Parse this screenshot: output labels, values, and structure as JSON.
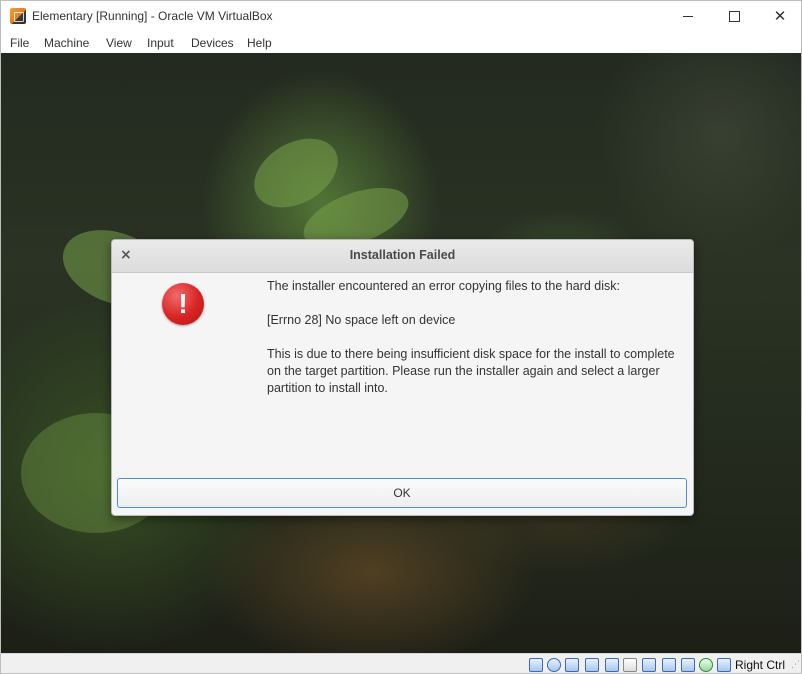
{
  "window": {
    "title": "Elementary [Running] - Oracle VM VirtualBox",
    "controls": {
      "minimize": "",
      "maximize": "",
      "close": "✕"
    }
  },
  "menu": [
    {
      "label": "File"
    },
    {
      "label": "Machine"
    },
    {
      "label": "View"
    },
    {
      "label": "Input"
    },
    {
      "label": "Devices"
    },
    {
      "label": "Help"
    }
  ],
  "dialog": {
    "close_glyph": "×",
    "title": "Installation Failed",
    "icon": "error-icon",
    "icon_glyph": "!",
    "messages": {
      "line1": "The installer encountered an error copying files to the hard disk:",
      "line2": "[Errno 28] No space left on device",
      "line3": "This is due to there being insufficient disk space for the install to complete on the target partition.  Please run the installer again and select a larger partition to install into."
    },
    "ok_label": "OK"
  },
  "statusbar": {
    "icons": [
      "hard-disk-icon",
      "optical-drive-icon",
      "audio-icon",
      "network-icon",
      "usb-icon",
      "shared-folders-icon",
      "display-icon",
      "video-capture-icon",
      "virtualization-icon",
      "mouse-integration-icon",
      "keyboard-icon"
    ],
    "host_key": "Right Ctrl"
  },
  "colors": {
    "accent": "#4a90d9",
    "error": "#d92323"
  }
}
